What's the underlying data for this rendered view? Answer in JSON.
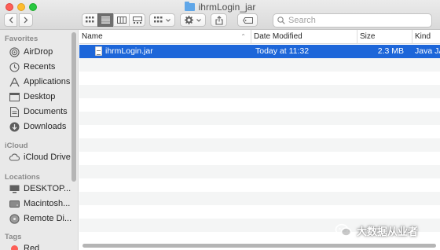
{
  "window": {
    "title": "ihrmLogin_jar"
  },
  "toolbar": {
    "back_icon": "chevron-left",
    "forward_icon": "chevron-right",
    "view_buttons": [
      "icon-view",
      "list-view",
      "column-view",
      "gallery-view"
    ],
    "group_icon": "grid-group",
    "action_icon": "gear",
    "share_icon": "share",
    "tag_icon": "tag"
  },
  "search": {
    "placeholder": "Search",
    "value": ""
  },
  "sidebar": {
    "sections": [
      {
        "title": "Favorites",
        "items": [
          {
            "label": "AirDrop",
            "icon": "airdrop"
          },
          {
            "label": "Recents",
            "icon": "clock"
          },
          {
            "label": "Applications",
            "icon": "applications"
          },
          {
            "label": "Desktop",
            "icon": "desktop"
          },
          {
            "label": "Documents",
            "icon": "document"
          },
          {
            "label": "Downloads",
            "icon": "download"
          }
        ]
      },
      {
        "title": "iCloud",
        "items": [
          {
            "label": "iCloud Drive",
            "icon": "cloud"
          }
        ]
      },
      {
        "title": "Locations",
        "items": [
          {
            "label": "DESKTOP...",
            "icon": "monitor"
          },
          {
            "label": "Macintosh...",
            "icon": "disk"
          },
          {
            "label": "Remote Di...",
            "icon": "disc"
          }
        ]
      },
      {
        "title": "Tags",
        "items": [
          {
            "label": "Red",
            "icon": "tag-dot",
            "color": "#fd5f57"
          }
        ]
      }
    ]
  },
  "columns": {
    "name": "Name",
    "date": "Date Modified",
    "size": "Size",
    "kind": "Kind"
  },
  "files": [
    {
      "name": "ihrmLogin.jar",
      "date": "Today at 11:32",
      "size": "2.3 MB",
      "kind": "Java JAR",
      "selected": true
    }
  ],
  "watermark": {
    "text": "大数据从业者"
  },
  "colors": {
    "selection": "#1d66d9",
    "sidebar": "#e9e9e9",
    "folder": "#5fa6e8"
  }
}
